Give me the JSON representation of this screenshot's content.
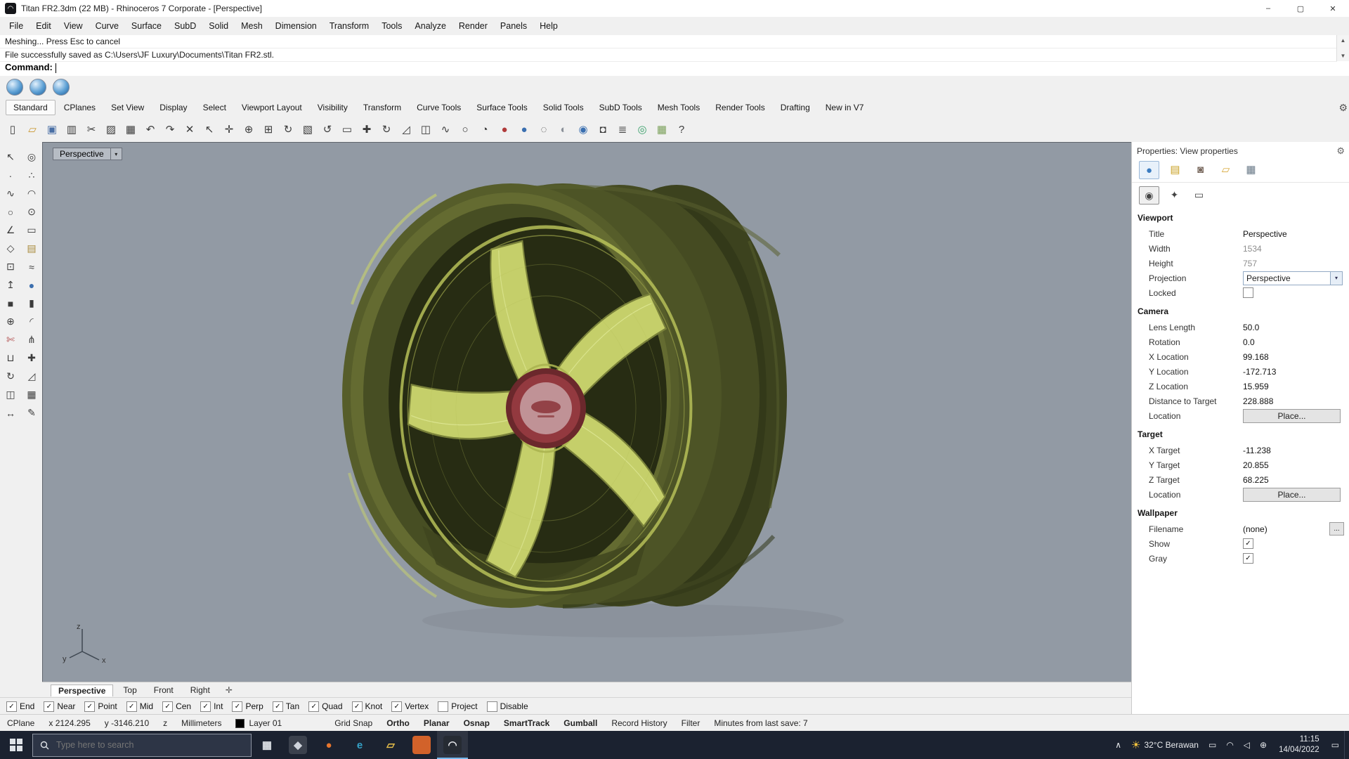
{
  "window": {
    "title": "Titan FR2.3dm (22 MB) - Rhinoceros 7 Corporate - [Perspective]",
    "logo_glyph": "◠",
    "controls": {
      "minimize": "–",
      "maximize": "▢",
      "close": "✕"
    }
  },
  "menu": {
    "items": [
      {
        "label": "File"
      },
      {
        "label": "Edit"
      },
      {
        "label": "View"
      },
      {
        "label": "Curve"
      },
      {
        "label": "Surface"
      },
      {
        "label": "SubD"
      },
      {
        "label": "Solid"
      },
      {
        "label": "Mesh"
      },
      {
        "label": "Dimension"
      },
      {
        "label": "Transform"
      },
      {
        "label": "Tools"
      },
      {
        "label": "Analyze"
      },
      {
        "label": "Render"
      },
      {
        "label": "Panels"
      },
      {
        "label": "Help"
      }
    ]
  },
  "command": {
    "history": [
      {
        "text": "Meshing... Press Esc to cancel"
      },
      {
        "text": "File successfully saved as C:\\Users\\JF Luxury\\Documents\\Titan FR2.stl."
      }
    ],
    "prompt": "Command:",
    "scroll_up": "▲",
    "scroll_down": "▼"
  },
  "render_buttons": [
    {
      "name": "render-icon"
    },
    {
      "name": "render-in-window-icon"
    },
    {
      "name": "render-preview-icon"
    }
  ],
  "toolbar_tabs": {
    "items": [
      {
        "label": "Standard",
        "active": true
      },
      {
        "label": "CPlanes"
      },
      {
        "label": "Set View"
      },
      {
        "label": "Display"
      },
      {
        "label": "Select"
      },
      {
        "label": "Viewport Layout"
      },
      {
        "label": "Visibility"
      },
      {
        "label": "Transform"
      },
      {
        "label": "Curve Tools"
      },
      {
        "label": "Surface Tools"
      },
      {
        "label": "Solid Tools"
      },
      {
        "label": "SubD Tools"
      },
      {
        "label": "Mesh Tools"
      },
      {
        "label": "Render Tools"
      },
      {
        "label": "Drafting"
      },
      {
        "label": "New in V7"
      }
    ],
    "gear_glyph": "⚙"
  },
  "main_toolbar": {
    "icons": [
      {
        "name": "new-file-icon",
        "glyph": "▯"
      },
      {
        "name": "open-file-icon",
        "glyph": "▱",
        "color": "#c9972f"
      },
      {
        "name": "save-icon",
        "glyph": "▣",
        "color": "#4a6fa5"
      },
      {
        "name": "print-icon",
        "glyph": "▥"
      },
      {
        "name": "cut-icon",
        "glyph": "✂"
      },
      {
        "name": "copy-icon",
        "glyph": "▨"
      },
      {
        "name": "paste-icon",
        "glyph": "▦"
      },
      {
        "name": "undo-icon",
        "glyph": "↶"
      },
      {
        "name": "redo-icon",
        "glyph": "↷"
      },
      {
        "name": "delete-icon",
        "glyph": "✕"
      },
      {
        "name": "select-icon",
        "glyph": "↖"
      },
      {
        "name": "pan-icon",
        "glyph": "✛"
      },
      {
        "name": "zoom-icon",
        "glyph": "⊕"
      },
      {
        "name": "zoom-extents-icon",
        "glyph": "⊞"
      },
      {
        "name": "rotate-view-icon",
        "glyph": "↻"
      },
      {
        "name": "zoom-window-icon",
        "glyph": "▧"
      },
      {
        "name": "undo-view-icon",
        "glyph": "↺"
      },
      {
        "name": "named-view-icon",
        "glyph": "▭"
      },
      {
        "name": "move-icon",
        "glyph": "✚"
      },
      {
        "name": "rotate-icon",
        "glyph": "↻"
      },
      {
        "name": "scale-icon",
        "glyph": "◿"
      },
      {
        "name": "mirror-icon",
        "glyph": "◫"
      },
      {
        "name": "curve-icon",
        "glyph": "∿"
      },
      {
        "name": "circle-icon",
        "glyph": "○"
      },
      {
        "name": "analyze-icon",
        "glyph": "◔"
      },
      {
        "name": "render-sphere-icon",
        "glyph": "●",
        "color": "#b03a3a"
      },
      {
        "name": "shaded-sphere-icon",
        "glyph": "●",
        "color": "#3a6fb0"
      },
      {
        "name": "wireframe-sphere-icon",
        "glyph": "◌"
      },
      {
        "name": "ghosted-sphere-icon",
        "glyph": "◐",
        "color": "#8a9099"
      },
      {
        "name": "raytrace-sphere-icon",
        "glyph": "◉",
        "color": "#3a6fb0"
      },
      {
        "name": "lock-icon",
        "glyph": "◘"
      },
      {
        "name": "layers-icon",
        "glyph": "≣"
      },
      {
        "name": "gumball-icon",
        "glyph": "◎",
        "color": "#3aa06a"
      },
      {
        "name": "grid-snap-icon",
        "glyph": "▦",
        "color": "#7aa05a"
      },
      {
        "name": "help-icon",
        "glyph": "?"
      }
    ]
  },
  "side_toolbar": {
    "icons": [
      {
        "name": "select-icon",
        "glyph": "↖"
      },
      {
        "name": "brush-select-icon",
        "glyph": "◎"
      },
      {
        "name": "point-icon",
        "glyph": "∙"
      },
      {
        "name": "point-cloud-icon",
        "glyph": "∴"
      },
      {
        "name": "curve-icon",
        "glyph": "∿"
      },
      {
        "name": "arc-icon",
        "glyph": "◠"
      },
      {
        "name": "circle-icon",
        "glyph": "○"
      },
      {
        "name": "ellipse-icon",
        "glyph": "⊙"
      },
      {
        "name": "polyline-icon",
        "glyph": "∠"
      },
      {
        "name": "rectangle-icon",
        "glyph": "▭"
      },
      {
        "name": "polygon-icon",
        "glyph": "◇"
      },
      {
        "name": "surface-icon",
        "glyph": "▤",
        "color": "#a8893a"
      },
      {
        "name": "plane-icon",
        "glyph": "⊡"
      },
      {
        "name": "loft-icon",
        "glyph": "≈"
      },
      {
        "name": "extrude-icon",
        "glyph": "↥"
      },
      {
        "name": "sphere-icon",
        "glyph": "●",
        "color": "#3c6fae"
      },
      {
        "name": "box-icon",
        "glyph": "■"
      },
      {
        "name": "cylinder-icon",
        "glyph": "▮"
      },
      {
        "name": "boolean-icon",
        "glyph": "⊕"
      },
      {
        "name": "fillet-icon",
        "glyph": "◜"
      },
      {
        "name": "trim-icon",
        "glyph": "✄",
        "color": "#b04a4a"
      },
      {
        "name": "split-icon",
        "glyph": "⋔"
      },
      {
        "name": "join-icon",
        "glyph": "⊔"
      },
      {
        "name": "move-icon",
        "glyph": "✚"
      },
      {
        "name": "rotate-icon",
        "glyph": "↻"
      },
      {
        "name": "scale-icon",
        "glyph": "◿"
      },
      {
        "name": "mirror-icon",
        "glyph": "◫"
      },
      {
        "name": "array-icon",
        "glyph": "▦"
      },
      {
        "name": "dimension-icon",
        "glyph": "↔"
      },
      {
        "name": "annotate-icon",
        "glyph": "✎"
      }
    ]
  },
  "viewport": {
    "chip_label": "Perspective",
    "chip_arrow": "▾",
    "axis": {
      "x": "x",
      "y": "y",
      "z": "z"
    },
    "tabs": {
      "items": [
        {
          "label": "Perspective",
          "active": true
        },
        {
          "label": "Top"
        },
        {
          "label": "Front"
        },
        {
          "label": "Right"
        }
      ],
      "add_glyph": "✛"
    },
    "model_colors": {
      "rim_dark_olive": "#3c421e",
      "rim_olive": "#565d2a",
      "spoke_mesh_yellow_green": "#c5cf6a",
      "hub_red": "#93393f",
      "hub_pink": "#c09296",
      "background_gray": "#929aa4"
    }
  },
  "osnap": {
    "items": [
      {
        "label": "End",
        "checked": true
      },
      {
        "label": "Near",
        "checked": true
      },
      {
        "label": "Point",
        "checked": true
      },
      {
        "label": "Mid",
        "checked": true
      },
      {
        "label": "Cen",
        "checked": true
      },
      {
        "label": "Int",
        "checked": true
      },
      {
        "label": "Perp",
        "checked": true
      },
      {
        "label": "Tan",
        "checked": true
      },
      {
        "label": "Quad",
        "checked": true
      },
      {
        "label": "Knot",
        "checked": true
      },
      {
        "label": "Vertex",
        "checked": true
      },
      {
        "label": "Project",
        "checked": false
      },
      {
        "label": "Disable",
        "checked": false
      }
    ]
  },
  "panel": {
    "header": "Properties: View properties",
    "gear_glyph": "⚙",
    "tabs": [
      {
        "name": "properties-tab-icon",
        "glyph": "●",
        "color": "#3a7bc0",
        "active": true
      },
      {
        "name": "layers-tab-icon",
        "glyph": "▤",
        "color": "#c9a227"
      },
      {
        "name": "rendering-tab-icon",
        "glyph": "◙",
        "color": "#7a6a5f"
      },
      {
        "name": "libraries-tab-icon",
        "glyph": "▱",
        "color": "#d8a93c"
      },
      {
        "name": "display-tab-icon",
        "glyph": "▦",
        "color": "#6a7a88"
      }
    ],
    "pages": [
      {
        "name": "viewport-page-icon",
        "glyph": "◉",
        "active": true
      },
      {
        "name": "light-page-icon",
        "glyph": "✦"
      },
      {
        "name": "display-page-icon",
        "glyph": "▭"
      }
    ],
    "viewport_section": {
      "title": "Viewport",
      "title_row": {
        "label": "Title",
        "value": "Perspective"
      },
      "width_row": {
        "label": "Width",
        "value": "1534"
      },
      "height_row": {
        "label": "Height",
        "value": "757"
      },
      "projection_row": {
        "label": "Projection",
        "value": "Perspective",
        "arrow": "▾"
      },
      "locked_row": {
        "label": "Locked",
        "checked": false
      }
    },
    "camera_section": {
      "title": "Camera",
      "lens_row": {
        "label": "Lens Length",
        "value": "50.0"
      },
      "rotation_row": {
        "label": "Rotation",
        "value": "0.0"
      },
      "x_row": {
        "label": "X Location",
        "value": "99.168"
      },
      "y_row": {
        "label": "Y Location",
        "value": "-172.713"
      },
      "z_row": {
        "label": "Z Location",
        "value": "15.959"
      },
      "distance_row": {
        "label": "Distance to Target",
        "value": "228.888"
      },
      "location_row": {
        "label": "Location",
        "button": "Place..."
      }
    },
    "target_section": {
      "title": "Target",
      "x_row": {
        "label": "X Target",
        "value": "-11.238"
      },
      "y_row": {
        "label": "Y Target",
        "value": "20.855"
      },
      "z_row": {
        "label": "Z Target",
        "value": "68.225"
      },
      "location_row": {
        "label": "Location",
        "button": "Place..."
      }
    },
    "wallpaper_section": {
      "title": "Wallpaper",
      "filename_row": {
        "label": "Filename",
        "value": "(none)",
        "browse": "..."
      },
      "show_row": {
        "label": "Show",
        "checked": true
      },
      "gray_row": {
        "label": "Gray",
        "checked": true
      }
    }
  },
  "status": {
    "left_items": [
      {
        "label": "CPlane"
      },
      {
        "label": "x 2124.295"
      },
      {
        "label": "y -3146.210"
      },
      {
        "label": "z"
      },
      {
        "label": "Millimeters"
      }
    ],
    "layer": {
      "label": "Layer 01",
      "swatch_color": "#000000"
    },
    "right_items": [
      {
        "label": "Grid Snap"
      },
      {
        "label": "Ortho",
        "bold": true
      },
      {
        "label": "Planar",
        "bold": true
      },
      {
        "label": "Osnap",
        "bold": true
      },
      {
        "label": "SmartTrack",
        "bold": true
      },
      {
        "label": "Gumball",
        "bold": true
      },
      {
        "label": "Record History"
      },
      {
        "label": "Filter"
      },
      {
        "label": "Minutes from last save: 7"
      }
    ]
  },
  "taskbar": {
    "search_placeholder": "Type here to search",
    "apps": [
      {
        "name": "task-view-icon",
        "glyph": "▦",
        "color": "#dfe3e8"
      },
      {
        "name": "pinned-app-icon",
        "glyph": "◆",
        "color": "#cfd4dc",
        "bg": "#3b414d"
      },
      {
        "name": "firefox-icon",
        "glyph": "●",
        "color": "#e8762d"
      },
      {
        "name": "edge-icon",
        "glyph": "e",
        "color": "#35a3c8"
      },
      {
        "name": "file-explorer-icon",
        "glyph": "▱",
        "color": "#e9c04a"
      },
      {
        "name": "pinned-app-orange-icon",
        "glyph": "",
        "color": "#ffffff",
        "bg": "#d2622a"
      },
      {
        "name": "rhino-icon",
        "glyph": "◠",
        "color": "#e8eaed",
        "bg": "#262b33",
        "active": true
      }
    ],
    "tray": {
      "expander_glyph": "∧",
      "weather_sun_glyph": "☀",
      "weather_label": "32°C Berawan",
      "icons": [
        {
          "name": "display-tray-icon",
          "glyph": "▭"
        },
        {
          "name": "network-tray-icon",
          "glyph": "◠"
        },
        {
          "name": "volume-tray-icon",
          "glyph": "◁"
        },
        {
          "name": "language-tray-icon",
          "glyph": "⊕"
        }
      ],
      "time": "11:15",
      "date": "14/04/2022",
      "action_center_glyph": "▭"
    }
  }
}
